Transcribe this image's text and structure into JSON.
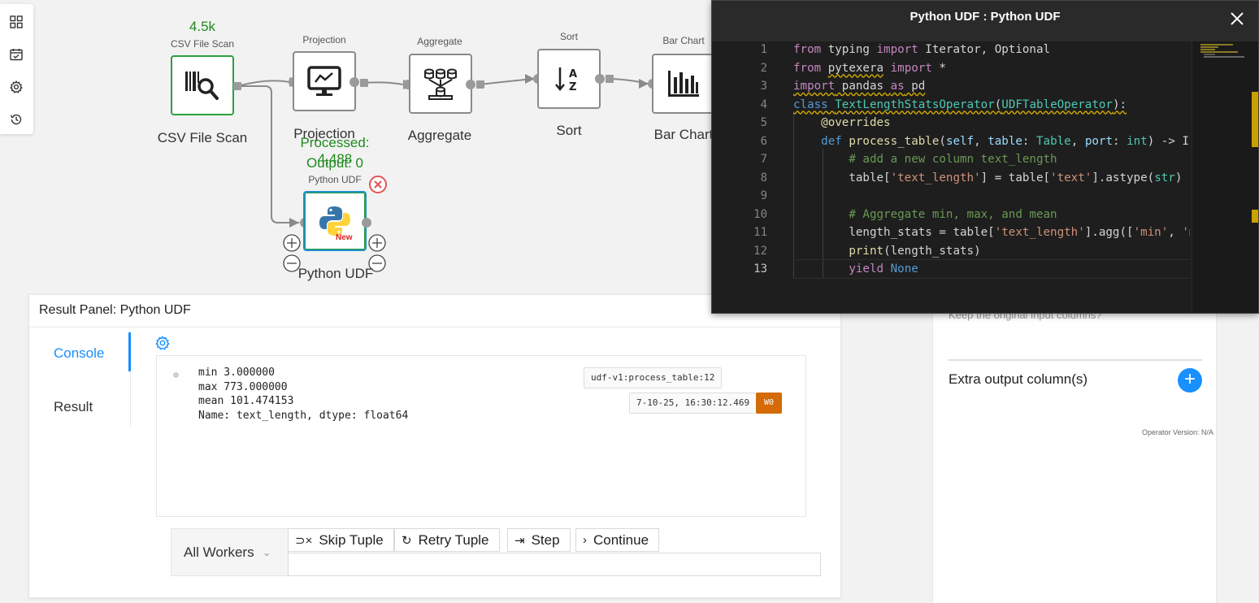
{
  "operators": {
    "csv": {
      "top": "CSV File Scan",
      "label": "CSV File Scan",
      "count": "4.5k"
    },
    "projection": {
      "top": "Projection",
      "label": "Projection"
    },
    "aggregate": {
      "top": "Aggregate",
      "label": "Aggregate"
    },
    "sort": {
      "top": "Sort",
      "label": "Sort"
    },
    "bar": {
      "top": "Bar Chart",
      "label": "Bar Chart"
    },
    "udf": {
      "top": "Python UDF",
      "label": "Python UDF",
      "processed": "Processed: 4,488",
      "output": "Output: 0",
      "badge": "New"
    }
  },
  "result_panel": {
    "title": "Result Panel: Python UDF",
    "tabs": {
      "console": "Console",
      "result": "Result"
    },
    "console_lines": [
      "min 3.000000",
      "max 773.000000",
      "mean 101.474153",
      "Name: text_length, dtype: float64"
    ],
    "source_tag": "udf-v1:process_table:12",
    "time_tag": "7-10-25, 16:30:12.469",
    "worker_tag": "W0",
    "workers_select": "All Workers",
    "buttons": {
      "skip": "Skip Tuple",
      "retry": "Retry Tuple",
      "step": "Step",
      "continue": "Continue"
    }
  },
  "properties": {
    "keep_columns": "Keep the original input columns?",
    "extra_output": "Extra output column(s)",
    "version": "Operator Version: N/A"
  },
  "editor": {
    "title": "Python UDF : Python UDF",
    "line_numbers": [
      "1",
      "2",
      "3",
      "4",
      "5",
      "6",
      "7",
      "8",
      "9",
      "10",
      "11",
      "12",
      "13"
    ]
  },
  "colors": {
    "accent": "#1890ff",
    "success": "#2e9e3f",
    "worker_badge": "#d46b08",
    "editor_bg": "#1e1e1e"
  }
}
